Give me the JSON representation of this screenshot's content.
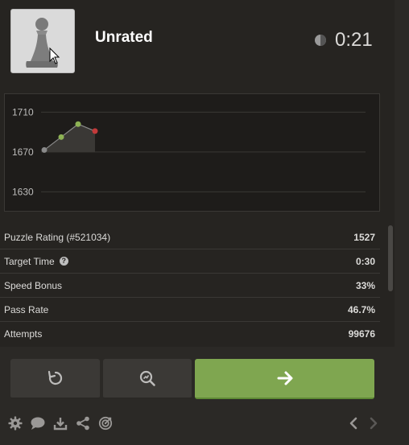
{
  "header": {
    "title": "Unrated",
    "timer": "0:21"
  },
  "chart_data": {
    "type": "line",
    "x": [
      1,
      2,
      3,
      4
    ],
    "values": [
      1672,
      1685,
      1698,
      1691
    ],
    "point_colors": [
      "#8a8a8a",
      "#8db254",
      "#8db254",
      "#c33a3a"
    ],
    "ytick_labels": [
      "1710",
      "1670",
      "1630"
    ],
    "yticks": [
      1710,
      1670,
      1630
    ],
    "ylim": [
      1615,
      1720
    ],
    "grid": true
  },
  "stats": [
    {
      "label": "Puzzle Rating (#521034)",
      "value": "1527"
    },
    {
      "label": "Target Time",
      "value": "0:30",
      "help": "?"
    },
    {
      "label": "Speed Bonus",
      "value": "33%"
    },
    {
      "label": "Pass Rate",
      "value": "46.7%"
    },
    {
      "label": "Attempts",
      "value": "99676"
    }
  ],
  "icons": {
    "retry": "retry-icon",
    "analyze": "analyze-icon",
    "next": "arrow-right-icon",
    "settings": "gear-icon",
    "chat": "chat-icon",
    "download": "download-icon",
    "share": "share-icon",
    "target": "target-icon",
    "prev": "chevron-left-icon",
    "nextnav": "chevron-right-icon"
  },
  "colors": {
    "accent": "#7fa650",
    "background": "#262421",
    "fail": "#c33a3a",
    "success": "#8db254"
  }
}
